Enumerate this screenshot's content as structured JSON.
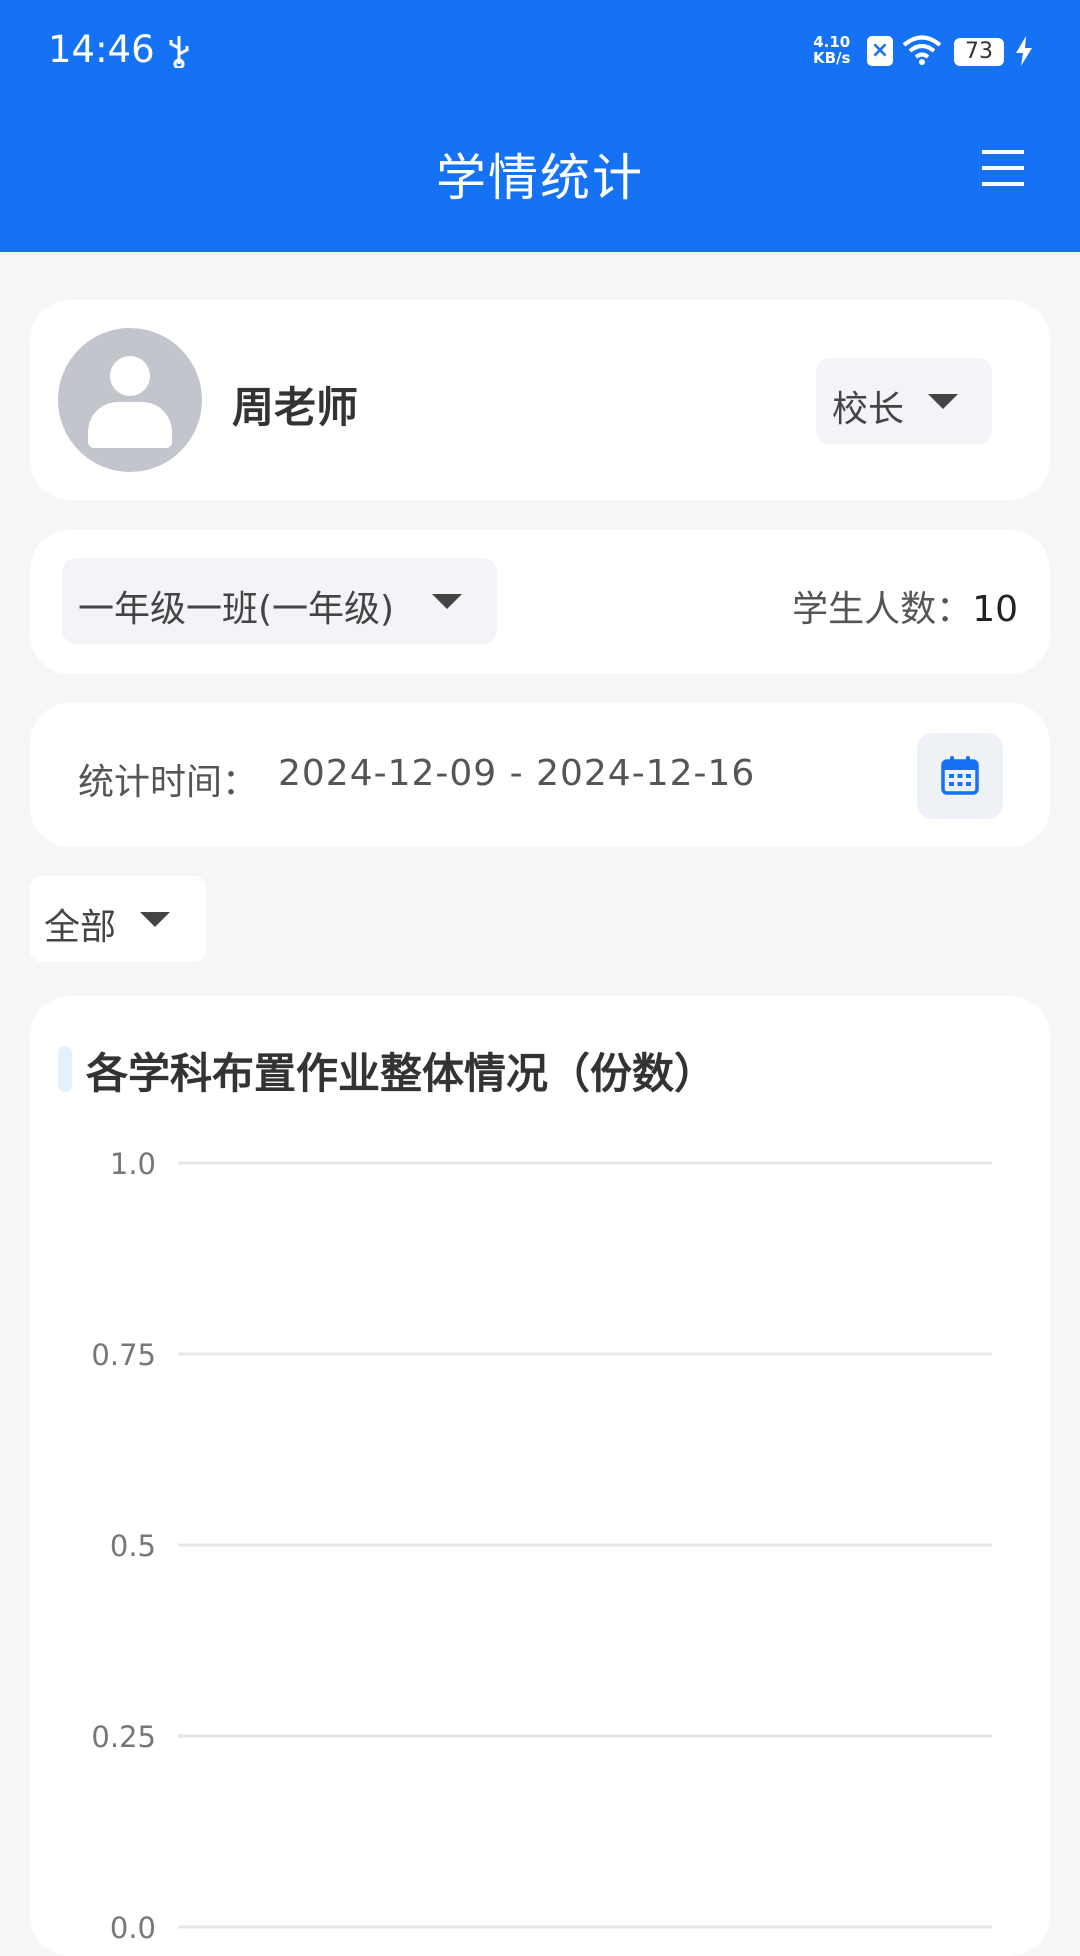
{
  "status_bar": {
    "time": "14:46",
    "net_speed_value": "4.10",
    "net_speed_unit": "KB/s",
    "battery": "73"
  },
  "app_bar": {
    "title": "学情统计"
  },
  "user": {
    "name": "周老师",
    "role": "校长"
  },
  "class_info": {
    "class_name": "一年级一班(一年级)",
    "student_count_label": "学生人数：",
    "student_count": "10"
  },
  "time_filter": {
    "label": "统计时间：",
    "range": "2024-12-09 - 2024-12-16"
  },
  "subject_filter": {
    "selected": "全部"
  },
  "colors": {
    "primary": "#1672f5",
    "background": "#f5f6f8",
    "gridline": "#e6e7ea"
  },
  "chart_data": {
    "type": "bar",
    "title": "各学科布置作业整体情况（份数）",
    "categories": [],
    "series": [],
    "ylim": [
      0,
      1
    ],
    "y_ticks": [
      "1.0",
      "0.75",
      "0.5",
      "0.25",
      "0.0"
    ],
    "grid": true
  }
}
